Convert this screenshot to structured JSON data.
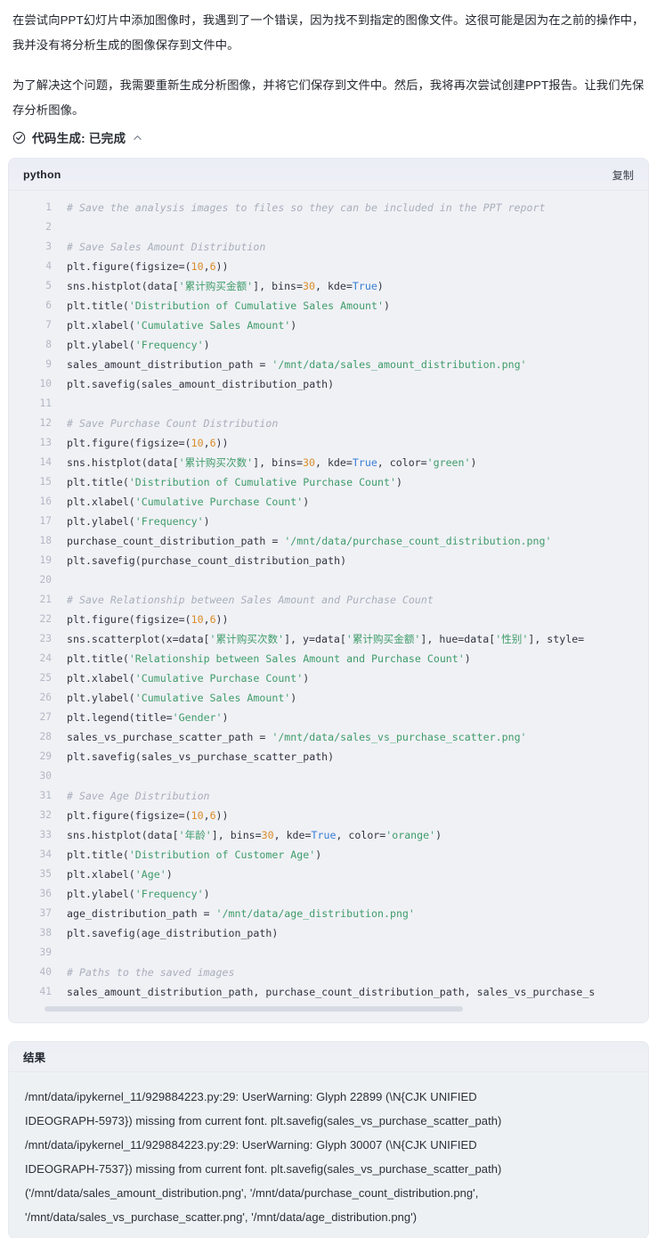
{
  "intro": {
    "paragraph_1": "在尝试向PPT幻灯片中添加图像时，我遇到了一个错误，因为找不到指定的图像文件。这很可能是因为在之前的操作中，我并没有将分析生成的图像保存到文件中。",
    "paragraph_2": "为了解决这个问题，我需要重新生成分析图像，并将它们保存到文件中。然后，我将再次尝试创建PPT报告。让我们先保存分析图像。"
  },
  "status": {
    "icon": "circle-check-icon",
    "label": "代码生成: 已完成",
    "chevron": "chevron-up-icon"
  },
  "code_block": {
    "language": "python",
    "copy_label": "复制",
    "scrollbar": "horizontal-scrollbar",
    "lines": [
      {
        "n": "1",
        "tokens": [
          {
            "t": "# Save the analysis images to files so they can be included in the PPT report",
            "c": "com"
          }
        ]
      },
      {
        "n": "2",
        "tokens": []
      },
      {
        "n": "3",
        "tokens": [
          {
            "t": "# Save Sales Amount Distribution",
            "c": "com"
          }
        ]
      },
      {
        "n": "4",
        "tokens": [
          {
            "t": "plt.figure(figsize=(",
            "c": "pln"
          },
          {
            "t": "10",
            "c": "num"
          },
          {
            "t": ",",
            "c": "pln"
          },
          {
            "t": "6",
            "c": "num"
          },
          {
            "t": "))",
            "c": "pln"
          }
        ]
      },
      {
        "n": "5",
        "tokens": [
          {
            "t": "sns.histplot(data[",
            "c": "pln"
          },
          {
            "t": "'累计购买金额'",
            "c": "str"
          },
          {
            "t": "], bins=",
            "c": "pln"
          },
          {
            "t": "30",
            "c": "num"
          },
          {
            "t": ", kde=",
            "c": "pln"
          },
          {
            "t": "True",
            "c": "kw"
          },
          {
            "t": ")",
            "c": "pln"
          }
        ]
      },
      {
        "n": "6",
        "tokens": [
          {
            "t": "plt.title(",
            "c": "pln"
          },
          {
            "t": "'Distribution of Cumulative Sales Amount'",
            "c": "str"
          },
          {
            "t": ")",
            "c": "pln"
          }
        ]
      },
      {
        "n": "7",
        "tokens": [
          {
            "t": "plt.xlabel(",
            "c": "pln"
          },
          {
            "t": "'Cumulative Sales Amount'",
            "c": "str"
          },
          {
            "t": ")",
            "c": "pln"
          }
        ]
      },
      {
        "n": "8",
        "tokens": [
          {
            "t": "plt.ylabel(",
            "c": "pln"
          },
          {
            "t": "'Frequency'",
            "c": "str"
          },
          {
            "t": ")",
            "c": "pln"
          }
        ]
      },
      {
        "n": "9",
        "tokens": [
          {
            "t": "sales_amount_distribution_path = ",
            "c": "pln"
          },
          {
            "t": "'/mnt/data/sales_amount_distribution.png'",
            "c": "str"
          }
        ]
      },
      {
        "n": "10",
        "tokens": [
          {
            "t": "plt.savefig(sales_amount_distribution_path)",
            "c": "pln"
          }
        ]
      },
      {
        "n": "11",
        "tokens": []
      },
      {
        "n": "12",
        "tokens": [
          {
            "t": "# Save Purchase Count Distribution",
            "c": "com"
          }
        ]
      },
      {
        "n": "13",
        "tokens": [
          {
            "t": "plt.figure(figsize=(",
            "c": "pln"
          },
          {
            "t": "10",
            "c": "num"
          },
          {
            "t": ",",
            "c": "pln"
          },
          {
            "t": "6",
            "c": "num"
          },
          {
            "t": "))",
            "c": "pln"
          }
        ]
      },
      {
        "n": "14",
        "tokens": [
          {
            "t": "sns.histplot(data[",
            "c": "pln"
          },
          {
            "t": "'累计购买次数'",
            "c": "str"
          },
          {
            "t": "], bins=",
            "c": "pln"
          },
          {
            "t": "30",
            "c": "num"
          },
          {
            "t": ", kde=",
            "c": "pln"
          },
          {
            "t": "True",
            "c": "kw"
          },
          {
            "t": ", color=",
            "c": "pln"
          },
          {
            "t": "'green'",
            "c": "str"
          },
          {
            "t": ")",
            "c": "pln"
          }
        ]
      },
      {
        "n": "15",
        "tokens": [
          {
            "t": "plt.title(",
            "c": "pln"
          },
          {
            "t": "'Distribution of Cumulative Purchase Count'",
            "c": "str"
          },
          {
            "t": ")",
            "c": "pln"
          }
        ]
      },
      {
        "n": "16",
        "tokens": [
          {
            "t": "plt.xlabel(",
            "c": "pln"
          },
          {
            "t": "'Cumulative Purchase Count'",
            "c": "str"
          },
          {
            "t": ")",
            "c": "pln"
          }
        ]
      },
      {
        "n": "17",
        "tokens": [
          {
            "t": "plt.ylabel(",
            "c": "pln"
          },
          {
            "t": "'Frequency'",
            "c": "str"
          },
          {
            "t": ")",
            "c": "pln"
          }
        ]
      },
      {
        "n": "18",
        "tokens": [
          {
            "t": "purchase_count_distribution_path = ",
            "c": "pln"
          },
          {
            "t": "'/mnt/data/purchase_count_distribution.png'",
            "c": "str"
          }
        ]
      },
      {
        "n": "19",
        "tokens": [
          {
            "t": "plt.savefig(purchase_count_distribution_path)",
            "c": "pln"
          }
        ]
      },
      {
        "n": "20",
        "tokens": []
      },
      {
        "n": "21",
        "tokens": [
          {
            "t": "# Save Relationship between Sales Amount and Purchase Count",
            "c": "com"
          }
        ]
      },
      {
        "n": "22",
        "tokens": [
          {
            "t": "plt.figure(figsize=(",
            "c": "pln"
          },
          {
            "t": "10",
            "c": "num"
          },
          {
            "t": ",",
            "c": "pln"
          },
          {
            "t": "6",
            "c": "num"
          },
          {
            "t": "))",
            "c": "pln"
          }
        ]
      },
      {
        "n": "23",
        "tokens": [
          {
            "t": "sns.scatterplot(x=data[",
            "c": "pln"
          },
          {
            "t": "'累计购买次数'",
            "c": "str"
          },
          {
            "t": "], y=data[",
            "c": "pln"
          },
          {
            "t": "'累计购买金额'",
            "c": "str"
          },
          {
            "t": "], hue=data[",
            "c": "pln"
          },
          {
            "t": "'性别'",
            "c": "str"
          },
          {
            "t": "], style=",
            "c": "pln"
          }
        ]
      },
      {
        "n": "24",
        "tokens": [
          {
            "t": "plt.title(",
            "c": "pln"
          },
          {
            "t": "'Relationship between Sales Amount and Purchase Count'",
            "c": "str"
          },
          {
            "t": ")",
            "c": "pln"
          }
        ]
      },
      {
        "n": "25",
        "tokens": [
          {
            "t": "plt.xlabel(",
            "c": "pln"
          },
          {
            "t": "'Cumulative Purchase Count'",
            "c": "str"
          },
          {
            "t": ")",
            "c": "pln"
          }
        ]
      },
      {
        "n": "26",
        "tokens": [
          {
            "t": "plt.ylabel(",
            "c": "pln"
          },
          {
            "t": "'Cumulative Sales Amount'",
            "c": "str"
          },
          {
            "t": ")",
            "c": "pln"
          }
        ]
      },
      {
        "n": "27",
        "tokens": [
          {
            "t": "plt.legend(title=",
            "c": "pln"
          },
          {
            "t": "'Gender'",
            "c": "str"
          },
          {
            "t": ")",
            "c": "pln"
          }
        ]
      },
      {
        "n": "28",
        "tokens": [
          {
            "t": "sales_vs_purchase_scatter_path = ",
            "c": "pln"
          },
          {
            "t": "'/mnt/data/sales_vs_purchase_scatter.png'",
            "c": "str"
          }
        ]
      },
      {
        "n": "29",
        "tokens": [
          {
            "t": "plt.savefig(sales_vs_purchase_scatter_path)",
            "c": "pln"
          }
        ]
      },
      {
        "n": "30",
        "tokens": []
      },
      {
        "n": "31",
        "tokens": [
          {
            "t": "# Save Age Distribution",
            "c": "com"
          }
        ]
      },
      {
        "n": "32",
        "tokens": [
          {
            "t": "plt.figure(figsize=(",
            "c": "pln"
          },
          {
            "t": "10",
            "c": "num"
          },
          {
            "t": ",",
            "c": "pln"
          },
          {
            "t": "6",
            "c": "num"
          },
          {
            "t": "))",
            "c": "pln"
          }
        ]
      },
      {
        "n": "33",
        "tokens": [
          {
            "t": "sns.histplot(data[",
            "c": "pln"
          },
          {
            "t": "'年龄'",
            "c": "str"
          },
          {
            "t": "], bins=",
            "c": "pln"
          },
          {
            "t": "30",
            "c": "num"
          },
          {
            "t": ", kde=",
            "c": "pln"
          },
          {
            "t": "True",
            "c": "kw"
          },
          {
            "t": ", color=",
            "c": "pln"
          },
          {
            "t": "'orange'",
            "c": "str"
          },
          {
            "t": ")",
            "c": "pln"
          }
        ]
      },
      {
        "n": "34",
        "tokens": [
          {
            "t": "plt.title(",
            "c": "pln"
          },
          {
            "t": "'Distribution of Customer Age'",
            "c": "str"
          },
          {
            "t": ")",
            "c": "pln"
          }
        ]
      },
      {
        "n": "35",
        "tokens": [
          {
            "t": "plt.xlabel(",
            "c": "pln"
          },
          {
            "t": "'Age'",
            "c": "str"
          },
          {
            "t": ")",
            "c": "pln"
          }
        ]
      },
      {
        "n": "36",
        "tokens": [
          {
            "t": "plt.ylabel(",
            "c": "pln"
          },
          {
            "t": "'Frequency'",
            "c": "str"
          },
          {
            "t": ")",
            "c": "pln"
          }
        ]
      },
      {
        "n": "37",
        "tokens": [
          {
            "t": "age_distribution_path = ",
            "c": "pln"
          },
          {
            "t": "'/mnt/data/age_distribution.png'",
            "c": "str"
          }
        ]
      },
      {
        "n": "38",
        "tokens": [
          {
            "t": "plt.savefig(age_distribution_path)",
            "c": "pln"
          }
        ]
      },
      {
        "n": "39",
        "tokens": []
      },
      {
        "n": "40",
        "tokens": [
          {
            "t": "# Paths to the saved images",
            "c": "com"
          }
        ]
      },
      {
        "n": "41",
        "tokens": [
          {
            "t": "sales_amount_distribution_path, purchase_count_distribution_path, sales_vs_purchase_s",
            "c": "pln"
          }
        ]
      }
    ]
  },
  "result_block": {
    "title": "结果",
    "lines": [
      "/mnt/data/ipykernel_11/929884223.py:29: UserWarning: Glyph 22899 (\\N{CJK UNIFIED",
      "IDEOGRAPH-5973}) missing from current font. plt.savefig(sales_vs_purchase_scatter_path)",
      "/mnt/data/ipykernel_11/929884223.py:29: UserWarning: Glyph 30007 (\\N{CJK UNIFIED",
      "IDEOGRAPH-7537}) missing from current font. plt.savefig(sales_vs_purchase_scatter_path)",
      "('/mnt/data/sales_amount_distribution.png', '/mnt/data/purchase_count_distribution.png',",
      "'/mnt/data/sales_vs_purchase_scatter.png', '/mnt/data/age_distribution.png')"
    ]
  },
  "colors": {
    "code_background": "#f0f1f5",
    "result_background": "#eef1f4",
    "string_token": "#3f9c6b",
    "number_token": "#d98c2b",
    "keyword_token": "#3a7fd5",
    "comment_token": "#a8aebb"
  }
}
